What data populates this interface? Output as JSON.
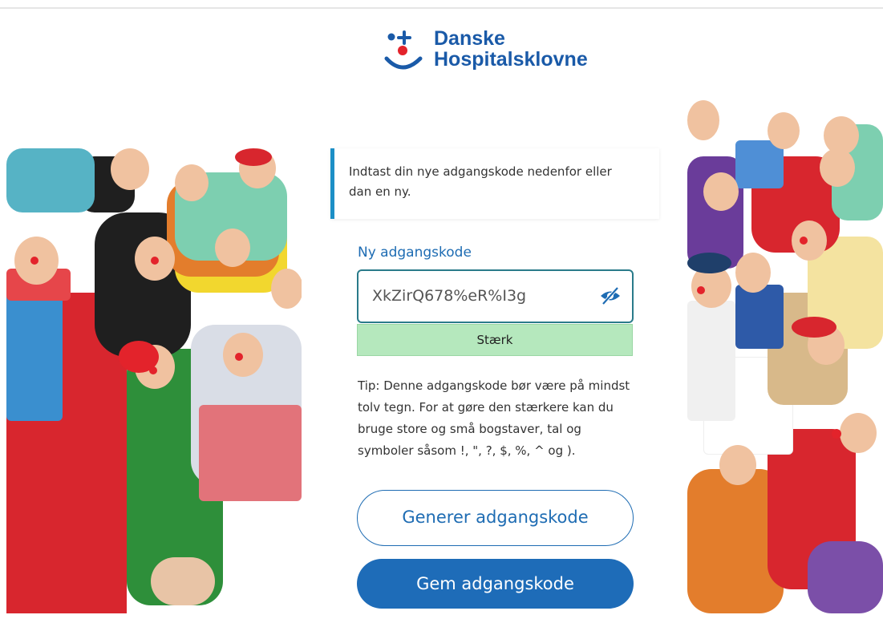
{
  "brand": {
    "line1": "Danske",
    "line2": "Hospitalsklovne",
    "color": "#1a5aa8",
    "accent_red": "#e3232b"
  },
  "info_message": "Indtast din nye adgangskode nedenfor eller dan en ny.",
  "password_field": {
    "label": "Ny adgangskode",
    "value": "XkZirQ678%eR%I3g",
    "toggle_icon": "eye-slash-icon"
  },
  "strength": {
    "label": "Stærk",
    "color": "#b5e8bd"
  },
  "tip": "Tip: Denne adgangskode bør være på mindst tolv tegn. For at gøre den stærkere kan du bruge store og små bogstaver, tal og symboler såsom !, \", ?, $, %, ^ og ).",
  "buttons": {
    "generate": "Generer adgangskode",
    "save": "Gem adgangskode"
  },
  "colors": {
    "primary": "#1e6cb8",
    "info_border": "#1c8fc6",
    "field_border": "#2a7b8a"
  }
}
